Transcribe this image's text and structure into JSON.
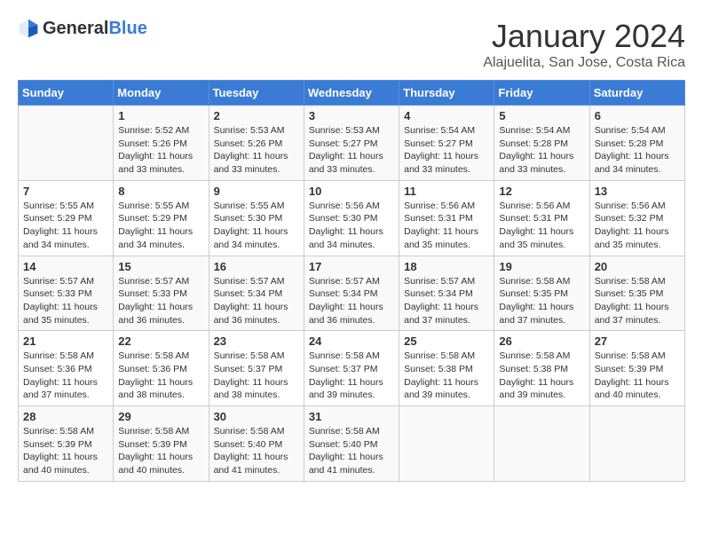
{
  "header": {
    "logo_general": "General",
    "logo_blue": "Blue",
    "title": "January 2024",
    "subtitle": "Alajuelita, San Jose, Costa Rica"
  },
  "days_of_week": [
    "Sunday",
    "Monday",
    "Tuesday",
    "Wednesday",
    "Thursday",
    "Friday",
    "Saturday"
  ],
  "weeks": [
    [
      {
        "day": "",
        "sunrise": "",
        "sunset": "",
        "daylight": ""
      },
      {
        "day": "1",
        "sunrise": "Sunrise: 5:52 AM",
        "sunset": "Sunset: 5:26 PM",
        "daylight": "Daylight: 11 hours and 33 minutes."
      },
      {
        "day": "2",
        "sunrise": "Sunrise: 5:53 AM",
        "sunset": "Sunset: 5:26 PM",
        "daylight": "Daylight: 11 hours and 33 minutes."
      },
      {
        "day": "3",
        "sunrise": "Sunrise: 5:53 AM",
        "sunset": "Sunset: 5:27 PM",
        "daylight": "Daylight: 11 hours and 33 minutes."
      },
      {
        "day": "4",
        "sunrise": "Sunrise: 5:54 AM",
        "sunset": "Sunset: 5:27 PM",
        "daylight": "Daylight: 11 hours and 33 minutes."
      },
      {
        "day": "5",
        "sunrise": "Sunrise: 5:54 AM",
        "sunset": "Sunset: 5:28 PM",
        "daylight": "Daylight: 11 hours and 33 minutes."
      },
      {
        "day": "6",
        "sunrise": "Sunrise: 5:54 AM",
        "sunset": "Sunset: 5:28 PM",
        "daylight": "Daylight: 11 hours and 34 minutes."
      }
    ],
    [
      {
        "day": "7",
        "sunrise": "Sunrise: 5:55 AM",
        "sunset": "Sunset: 5:29 PM",
        "daylight": "Daylight: 11 hours and 34 minutes."
      },
      {
        "day": "8",
        "sunrise": "Sunrise: 5:55 AM",
        "sunset": "Sunset: 5:29 PM",
        "daylight": "Daylight: 11 hours and 34 minutes."
      },
      {
        "day": "9",
        "sunrise": "Sunrise: 5:55 AM",
        "sunset": "Sunset: 5:30 PM",
        "daylight": "Daylight: 11 hours and 34 minutes."
      },
      {
        "day": "10",
        "sunrise": "Sunrise: 5:56 AM",
        "sunset": "Sunset: 5:30 PM",
        "daylight": "Daylight: 11 hours and 34 minutes."
      },
      {
        "day": "11",
        "sunrise": "Sunrise: 5:56 AM",
        "sunset": "Sunset: 5:31 PM",
        "daylight": "Daylight: 11 hours and 35 minutes."
      },
      {
        "day": "12",
        "sunrise": "Sunrise: 5:56 AM",
        "sunset": "Sunset: 5:31 PM",
        "daylight": "Daylight: 11 hours and 35 minutes."
      },
      {
        "day": "13",
        "sunrise": "Sunrise: 5:56 AM",
        "sunset": "Sunset: 5:32 PM",
        "daylight": "Daylight: 11 hours and 35 minutes."
      }
    ],
    [
      {
        "day": "14",
        "sunrise": "Sunrise: 5:57 AM",
        "sunset": "Sunset: 5:33 PM",
        "daylight": "Daylight: 11 hours and 35 minutes."
      },
      {
        "day": "15",
        "sunrise": "Sunrise: 5:57 AM",
        "sunset": "Sunset: 5:33 PM",
        "daylight": "Daylight: 11 hours and 36 minutes."
      },
      {
        "day": "16",
        "sunrise": "Sunrise: 5:57 AM",
        "sunset": "Sunset: 5:34 PM",
        "daylight": "Daylight: 11 hours and 36 minutes."
      },
      {
        "day": "17",
        "sunrise": "Sunrise: 5:57 AM",
        "sunset": "Sunset: 5:34 PM",
        "daylight": "Daylight: 11 hours and 36 minutes."
      },
      {
        "day": "18",
        "sunrise": "Sunrise: 5:57 AM",
        "sunset": "Sunset: 5:34 PM",
        "daylight": "Daylight: 11 hours and 37 minutes."
      },
      {
        "day": "19",
        "sunrise": "Sunrise: 5:58 AM",
        "sunset": "Sunset: 5:35 PM",
        "daylight": "Daylight: 11 hours and 37 minutes."
      },
      {
        "day": "20",
        "sunrise": "Sunrise: 5:58 AM",
        "sunset": "Sunset: 5:35 PM",
        "daylight": "Daylight: 11 hours and 37 minutes."
      }
    ],
    [
      {
        "day": "21",
        "sunrise": "Sunrise: 5:58 AM",
        "sunset": "Sunset: 5:36 PM",
        "daylight": "Daylight: 11 hours and 37 minutes."
      },
      {
        "day": "22",
        "sunrise": "Sunrise: 5:58 AM",
        "sunset": "Sunset: 5:36 PM",
        "daylight": "Daylight: 11 hours and 38 minutes."
      },
      {
        "day": "23",
        "sunrise": "Sunrise: 5:58 AM",
        "sunset": "Sunset: 5:37 PM",
        "daylight": "Daylight: 11 hours and 38 minutes."
      },
      {
        "day": "24",
        "sunrise": "Sunrise: 5:58 AM",
        "sunset": "Sunset: 5:37 PM",
        "daylight": "Daylight: 11 hours and 39 minutes."
      },
      {
        "day": "25",
        "sunrise": "Sunrise: 5:58 AM",
        "sunset": "Sunset: 5:38 PM",
        "daylight": "Daylight: 11 hours and 39 minutes."
      },
      {
        "day": "26",
        "sunrise": "Sunrise: 5:58 AM",
        "sunset": "Sunset: 5:38 PM",
        "daylight": "Daylight: 11 hours and 39 minutes."
      },
      {
        "day": "27",
        "sunrise": "Sunrise: 5:58 AM",
        "sunset": "Sunset: 5:39 PM",
        "daylight": "Daylight: 11 hours and 40 minutes."
      }
    ],
    [
      {
        "day": "28",
        "sunrise": "Sunrise: 5:58 AM",
        "sunset": "Sunset: 5:39 PM",
        "daylight": "Daylight: 11 hours and 40 minutes."
      },
      {
        "day": "29",
        "sunrise": "Sunrise: 5:58 AM",
        "sunset": "Sunset: 5:39 PM",
        "daylight": "Daylight: 11 hours and 40 minutes."
      },
      {
        "day": "30",
        "sunrise": "Sunrise: 5:58 AM",
        "sunset": "Sunset: 5:40 PM",
        "daylight": "Daylight: 11 hours and 41 minutes."
      },
      {
        "day": "31",
        "sunrise": "Sunrise: 5:58 AM",
        "sunset": "Sunset: 5:40 PM",
        "daylight": "Daylight: 11 hours and 41 minutes."
      },
      {
        "day": "",
        "sunrise": "",
        "sunset": "",
        "daylight": ""
      },
      {
        "day": "",
        "sunrise": "",
        "sunset": "",
        "daylight": ""
      },
      {
        "day": "",
        "sunrise": "",
        "sunset": "",
        "daylight": ""
      }
    ]
  ]
}
